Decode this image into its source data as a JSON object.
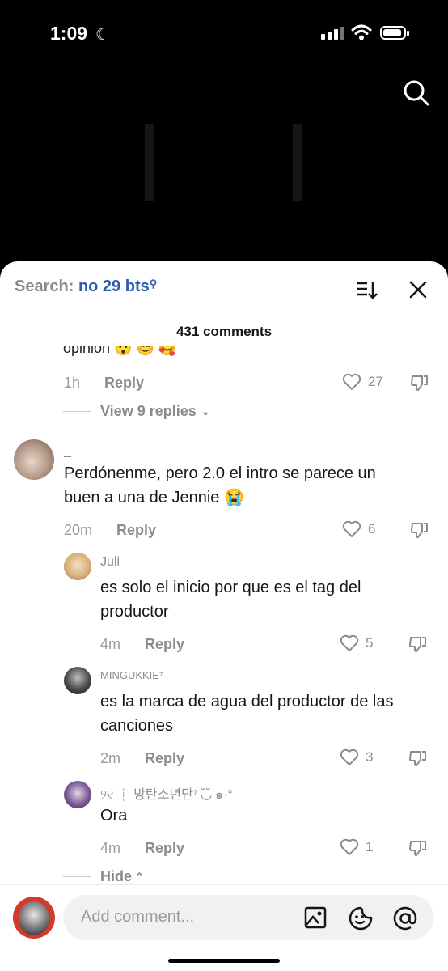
{
  "status": {
    "time": "1:09"
  },
  "sheet": {
    "search_label": "Search:",
    "search_query": "no 29 bts",
    "comment_count": "431 comments"
  },
  "top_comment": {
    "partial_text": "opinion 😯 😊 🥰",
    "time": "1h",
    "reply_label": "Reply",
    "likes": "27",
    "view_replies": "View 9 replies"
  },
  "comment": {
    "username": "_",
    "text_line1": "Perdónenme, pero 2.0 el intro se parece un",
    "text_line2": "buen a una de Jennie 😭",
    "time": "20m",
    "reply_label": "Reply",
    "likes": "6"
  },
  "replies": [
    {
      "username": "Juli",
      "text_line1": "es solo el inicio por que es el tag del",
      "text_line2": "productor",
      "time": "4m",
      "reply_label": "Reply",
      "likes": "5"
    },
    {
      "username": "MINGUKKIE⁷",
      "text_line1": "es la marca de agua del productor de las",
      "text_line2": "canciones",
      "time": "2m",
      "reply_label": "Reply",
      "likes": "3"
    },
    {
      "username": "୨୧ ┆ 방탄소년단⁷ ◟̆◞̆ ๑·°",
      "text_line1": "Ora",
      "time": "4m",
      "reply_label": "Reply",
      "likes": "1"
    }
  ],
  "hide_label": "Hide",
  "composer": {
    "placeholder": "Add comment..."
  },
  "colors": {
    "accent": "#2b5db0",
    "muted": "#8c8c8c",
    "sheet_bg": "#ffffff"
  }
}
